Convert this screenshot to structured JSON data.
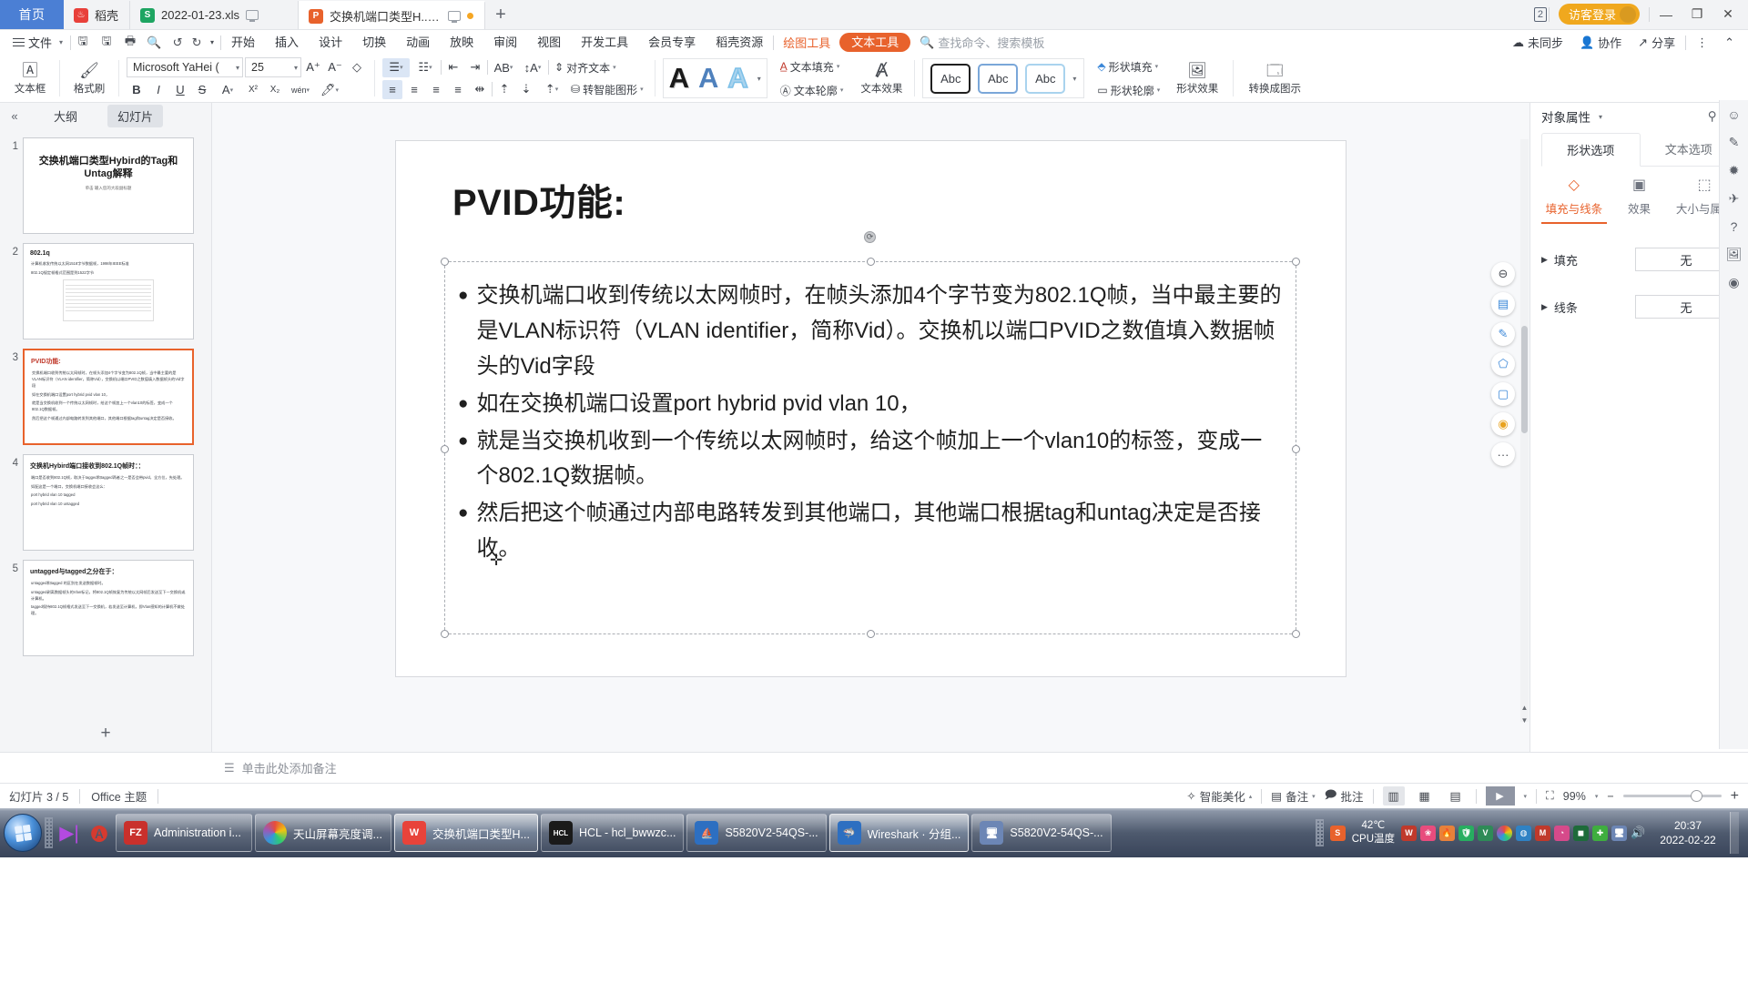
{
  "titlebar": {
    "home_label": "首页",
    "tabs": [
      {
        "icon": "wps-docer-icon",
        "label": "稻壳",
        "kind": "red",
        "modified": false,
        "has_cast": false
      },
      {
        "icon": "excel-file-icon",
        "label": "2022-01-23.xls",
        "kind": "green",
        "modified": false,
        "has_cast": true
      },
      {
        "icon": "powerpoint-file-icon",
        "label": "交换机端口类型H...和Untag解释",
        "kind": "orange",
        "modified": true,
        "has_cast": true
      }
    ],
    "new_tab": "+",
    "window_count": "2",
    "login_label": "访客登录",
    "minimize": "—",
    "maximize": "❐",
    "close": "✕"
  },
  "menubar": {
    "file_label": "文件",
    "quick_icons": [
      "save-icon",
      "save-as-icon",
      "print-icon",
      "print-preview-icon",
      "undo-icon",
      "redo-icon",
      "customize-qat-icon"
    ],
    "items": [
      "开始",
      "插入",
      "设计",
      "切换",
      "动画",
      "放映",
      "审阅",
      "视图",
      "开发工具",
      "会员专享",
      "稻壳资源"
    ],
    "context_tabs": [
      {
        "label": "绘图工具",
        "selected": false
      },
      {
        "label": "文本工具",
        "selected": true
      }
    ],
    "search_placeholder": "查找命令、搜索模板",
    "right_items": [
      {
        "icon": "cloud-sync-icon",
        "label": "未同步"
      },
      {
        "icon": "collaborate-icon",
        "label": "协作"
      },
      {
        "icon": "share-icon",
        "label": "分享"
      }
    ],
    "more_icon": "⋮",
    "collapse_icon": "⌃"
  },
  "ribbon": {
    "textbox_label": "文本框",
    "format_painter_label": "格式刷",
    "font_name": "Microsoft YaHei (",
    "font_size": "25",
    "grow_font": "A⁺",
    "shrink_font": "A⁻",
    "clear_format": "clear-format-icon",
    "bold": "B",
    "italic": "I",
    "underline": "U",
    "strikethrough": "S",
    "text_color": "A",
    "superscript": "X²",
    "subscript": "X₂",
    "phonetic": "wén",
    "highlight": "highlight-icon",
    "align_text_label": "对齐文本",
    "convert_smartart_label": "转智能图形",
    "wordart_samples": [
      "A",
      "A",
      "A"
    ],
    "text_fill_label": "文本填充",
    "text_outline_label": "文本轮廓",
    "text_effect_label": "文本效果",
    "shape_styles": [
      "Abc",
      "Abc",
      "Abc"
    ],
    "shape_fill_label": "形状填充",
    "shape_outline_label": "形状轮廓",
    "shape_effect_label": "形状效果",
    "convert_icon_label": "转换成图示"
  },
  "slidepanel": {
    "collapse_icon": "«",
    "tabs": [
      {
        "label": "大纲",
        "active": false
      },
      {
        "label": "幻灯片",
        "active": true
      }
    ],
    "add_slide": "+",
    "slides": [
      {
        "num": "1",
        "active": false,
        "layout": "title",
        "title": "交换机端口类型Hybird的Tag和Untag解释",
        "subtitle": "单击 输入您的大段副标题",
        "bullets": []
      },
      {
        "num": "2",
        "active": false,
        "layout": "content-image",
        "title": "802.1q",
        "title_red": false,
        "bullets": [
          "计算机收发传统以太网1518字节数据帧，1998年IEEE标准",
          "802.1Q规定帧格式范围是到1522字节"
        ]
      },
      {
        "num": "3",
        "active": true,
        "layout": "content",
        "title": "PVID功能:",
        "title_red": true,
        "bullets": [
          "交换机端口收到传统以太网帧时，在帧头添加4个字节变为802.1Q帧，当中最主要的是VLAN标识符（VLAN identifier，简称Vid），交换机以端口PVID之数值填入数据帧头的Vid字段",
          "如在交换机端口设置port hybrid pvid vlan 10，",
          "就是当交换机收到一个传统以太网帧时，给这个帧加上一个vlan10的标签，变成一个802.1Q数据帧。",
          "然后把这个帧通过内部电路转发到其他端口，其他端口根据tag和untag决定是否接收。"
        ]
      },
      {
        "num": "4",
        "active": false,
        "layout": "content",
        "title": "交换机Hybird端口接收到802.1Q帧时：：",
        "title_red": false,
        "bullets": [
          "端口是否收到802.1Q帧，取决于tagged和tagged两者之一是否会带pvid，全方位，先处理。",
          "如配这是一个端口，交换机端口接收会这么：",
          "port hybrid  vlan 10 tagged",
          "port hybrid  vlan 10 untagged"
        ]
      },
      {
        "num": "5",
        "active": false,
        "layout": "content",
        "title": "untagged与tagged之分在于：",
        "title_red": false,
        "bullets": [
          "untagged和tagged 的区别在发送数据帧时。",
          "untagged剥离数据帧头的Vlan标记，将802.1Q帧恢复为传统以太网帧后发送至下一交换机或计算机。",
          "tagged保持802.1Q帧格式发送至下一交换机，若发送至计算机，即Vlan感知的计算机不做处理。"
        ]
      }
    ]
  },
  "slide": {
    "title": "PVID功能:",
    "bullets": [
      {
        "marker": "●",
        "text": "交换机端口收到传统以太网帧时，在帧头添加4个字节变为802.1Q帧，当中最主要的是VLAN标识符（VLAN identifier，简称Vid）。交换机以端口PVID之数值填入数据帧头的Vid字段"
      },
      {
        "marker": "●",
        "text": "如在交换机端口设置port hybrid pvid vlan 10，"
      },
      {
        "marker": "●",
        "text": "就是当交换机收到一个传统以太网帧时，给这个帧加上一个vlan10的标签，变成一个802.1Q数据帧。"
      },
      {
        "marker": "●",
        "text": "然后把这个帧通过内部电路转发到其他端口，其他端口根据tag和untag决定是否接收。"
      }
    ],
    "float_tools": [
      {
        "icon": "minus-circle-icon",
        "glyph": "⊖"
      },
      {
        "icon": "layers-icon",
        "glyph": "▤"
      },
      {
        "icon": "pen-icon",
        "glyph": "✎"
      },
      {
        "icon": "shape-icon",
        "glyph": "⬠"
      },
      {
        "icon": "frame-icon",
        "glyph": "▢"
      },
      {
        "icon": "lightbulb-icon",
        "glyph": "💡"
      },
      {
        "icon": "more-icon",
        "glyph": "···"
      }
    ]
  },
  "notes": {
    "placeholder": "单击此处添加备注",
    "icon": "notes-icon"
  },
  "props": {
    "title": "对象属性",
    "pin_icon": "📌",
    "close_icon": "✕",
    "tabs": [
      {
        "label": "形状选项",
        "active": true
      },
      {
        "label": "文本选项",
        "active": false
      }
    ],
    "subtabs": [
      {
        "label": "填充与线条",
        "icon": "fill-line-icon",
        "active": true
      },
      {
        "label": "效果",
        "icon": "effects-icon",
        "active": false
      },
      {
        "label": "大小与属性",
        "icon": "size-properties-icon",
        "active": false
      }
    ],
    "rows": [
      {
        "label": "填充",
        "value": "无"
      },
      {
        "label": "线条",
        "value": "无"
      }
    ]
  },
  "rail": {
    "icons": [
      "help-circle-icon",
      "feedback-icon",
      "star-icon",
      "rocket-icon",
      "question-icon",
      "image-icon",
      "location-icon"
    ]
  },
  "statusbar": {
    "slide_counter": "幻灯片 3 / 5",
    "theme": "Office 主题",
    "beautify_label": "智能美化",
    "notes_label": "备注",
    "comment_label": "批注",
    "view_buttons": [
      "normal-view-icon",
      "slide-sorter-icon",
      "reading-view-icon"
    ],
    "play_label": "▶",
    "fit_icon": "fit-slide-icon",
    "zoom_level": "99%",
    "zoom_out": "−",
    "zoom_in": "+"
  },
  "taskbar": {
    "start": "start-orb-icon",
    "quick_launch": [
      "media-player-icon",
      "acrobat-icon"
    ],
    "buttons": [
      {
        "label": "Administration i...",
        "icon": "fz-icon",
        "color": "#c9302c",
        "active": false
      },
      {
        "label": "天山屏幕亮度调...",
        "icon": "color-wheel-icon",
        "color": "#ffffff",
        "active": false
      },
      {
        "label": "交换机端口类型H...",
        "icon": "wps-icon",
        "color": "#e8433a",
        "active": true
      },
      {
        "label": "HCL - hcl_bwwzc...",
        "icon": "hcl-icon",
        "color": "#1a1a1a",
        "active": false
      },
      {
        "label": "S5820V2-54QS-...",
        "icon": "putty-icon",
        "color": "#1c5fa8",
        "active": false
      },
      {
        "label": "Wireshark · 分组...",
        "icon": "wireshark-icon",
        "color": "#1c5fa8",
        "active": true
      },
      {
        "label": "S5820V2-54QS-...",
        "icon": "terminal-icon",
        "color": "#5a7fb5",
        "active": false
      }
    ],
    "cpu_temp": "42℃",
    "cpu_temp_label": "CPU温度",
    "tray_icons": [
      "wps-tray-icon",
      "w-tray-icon",
      "flower-tray-icon",
      "flame-tray-icon",
      "shield-tray-icon",
      "video-tray-icon",
      "color-tray-icon",
      "globe-tray-icon",
      "m-tray-icon",
      "drop-tray-icon",
      "green-tray-icon",
      "plus-tray-icon",
      "monitor-tray-icon",
      "volume-tray-icon"
    ],
    "time": "20:37",
    "date": "2022-02-22"
  }
}
